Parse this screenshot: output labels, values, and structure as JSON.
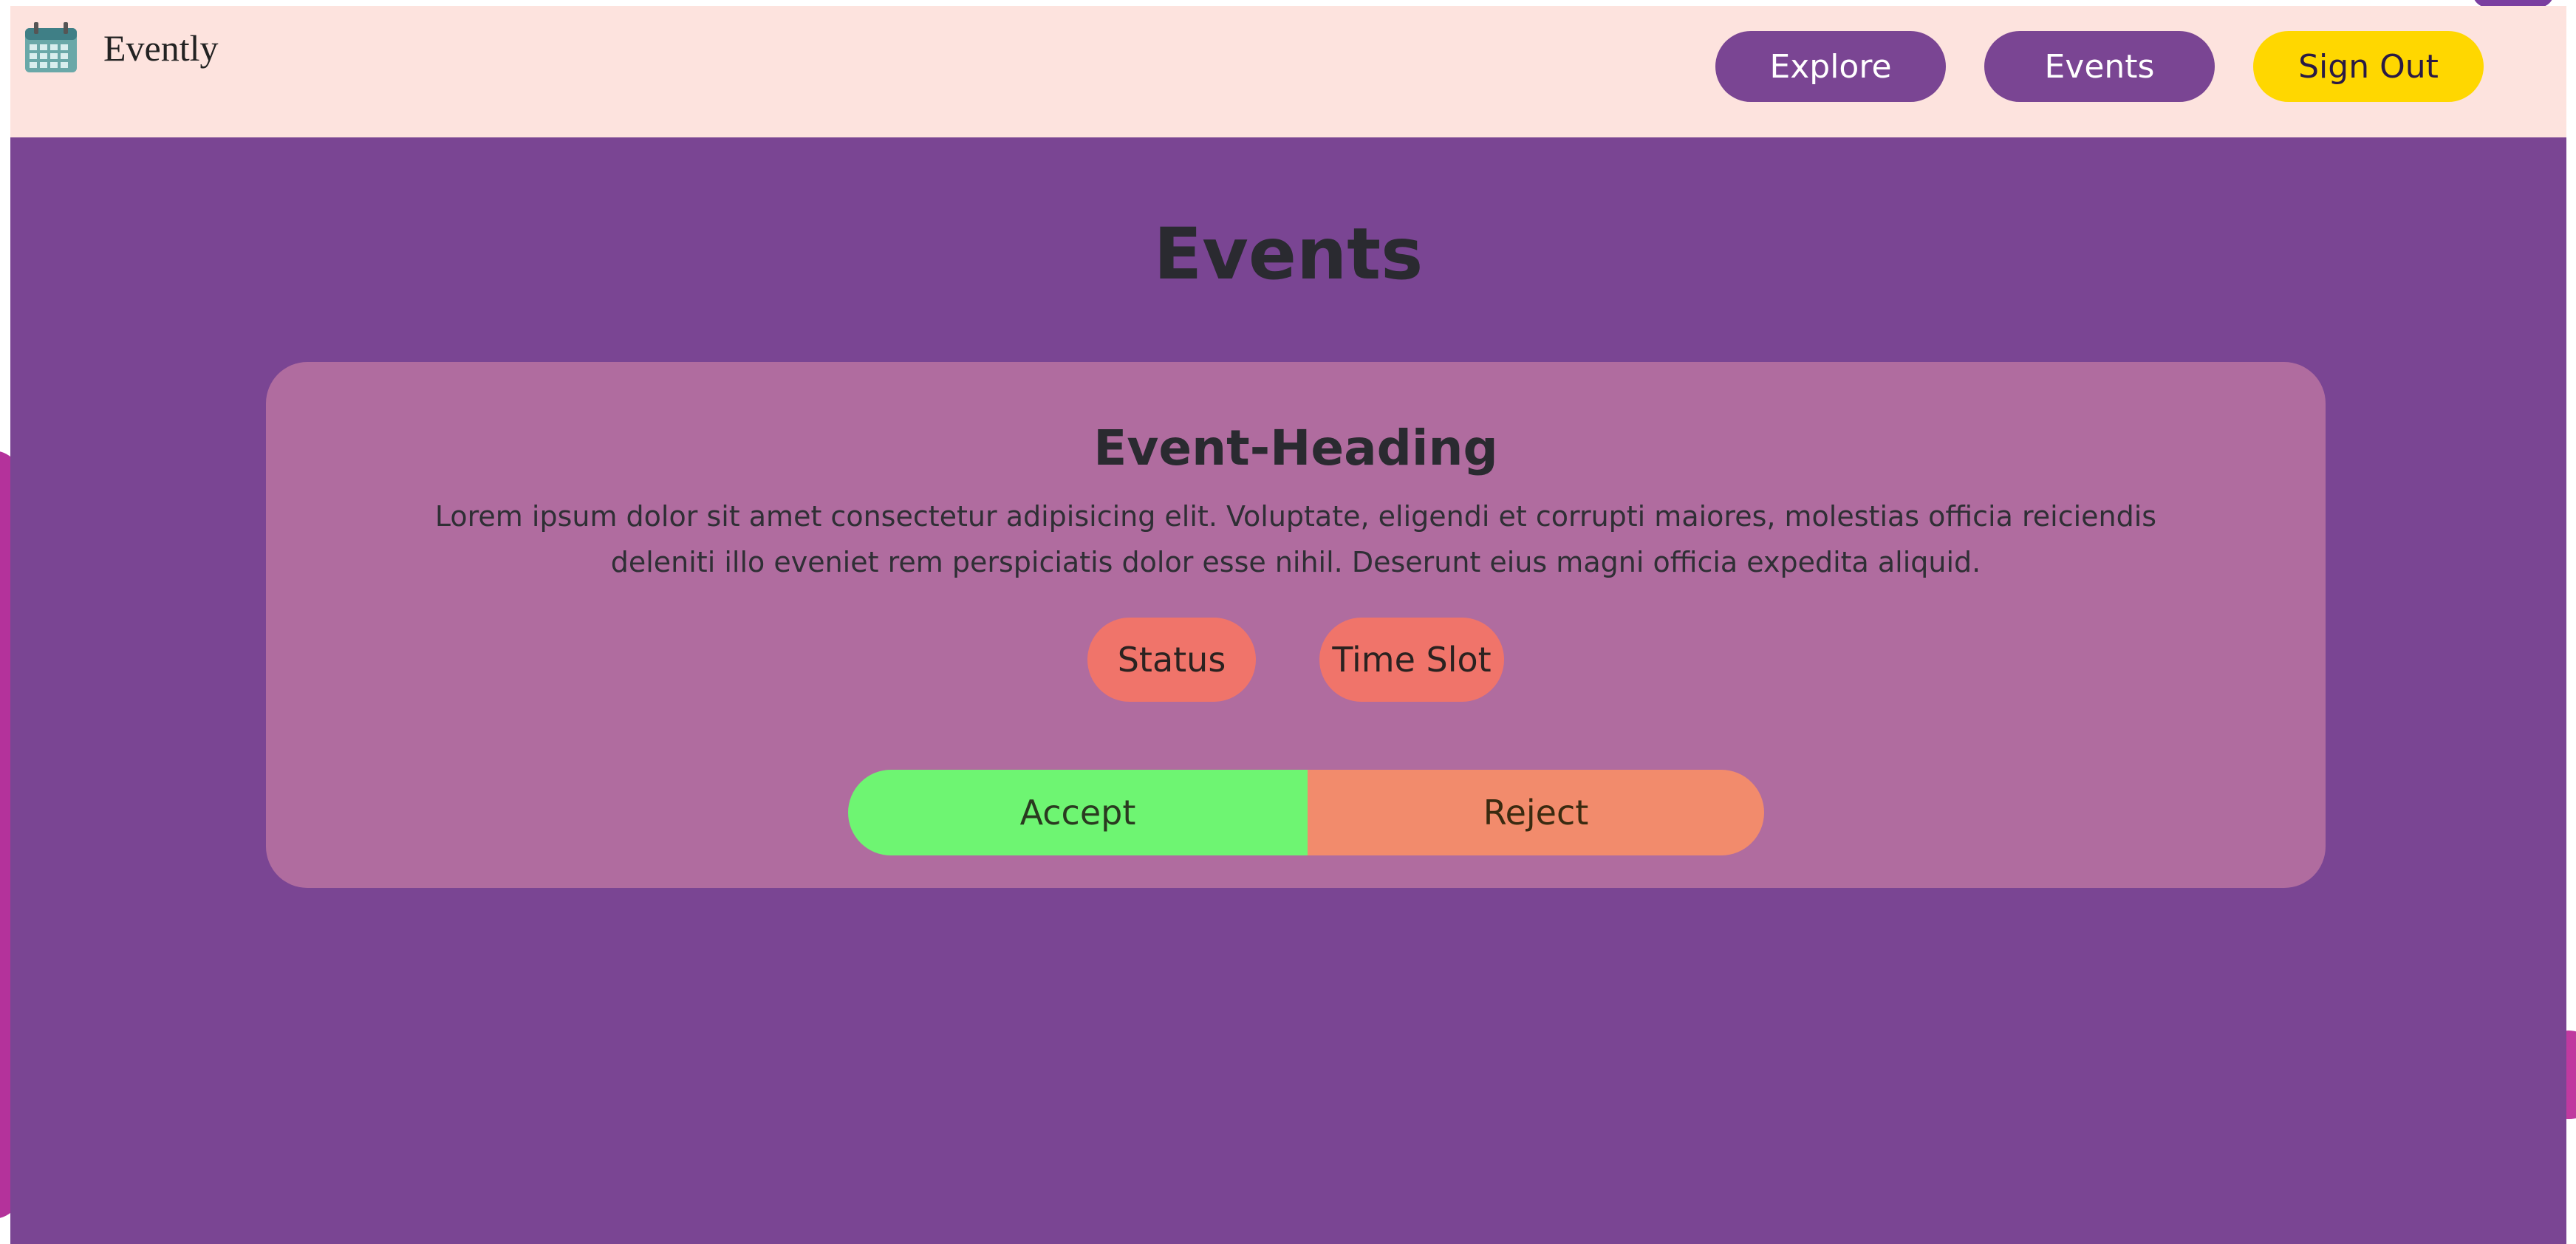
{
  "navbar": {
    "brand_icon": "calendar-icon",
    "brand_name": "Evently",
    "explore_label": "Explore",
    "events_label": "Events",
    "signout_label": "Sign Out"
  },
  "page": {
    "title": "Events"
  },
  "event": {
    "heading": "Event-Heading",
    "description": "Lorem ipsum dolor sit amet consectetur adipisicing elit. Voluptate, eligendi et corrupti maiores, molestias officia reiciendis deleniti illo eveniet rem perspiciatis dolor esse nihil. Deserunt eius magni officia expedita aliquid.",
    "status_label": "Status",
    "timeslot_label": "Time Slot",
    "accept_label": "Accept",
    "reject_label": "Reject"
  },
  "colors": {
    "navbar_bg": "#fde3de",
    "page_bg": "#7a4593",
    "card_bg": "#b06c9f",
    "nav_button": "#7a4593",
    "signout_button": "#ffd700",
    "chip": "#f0746a",
    "accept": "#6ef572",
    "reject": "#f28b6c"
  }
}
